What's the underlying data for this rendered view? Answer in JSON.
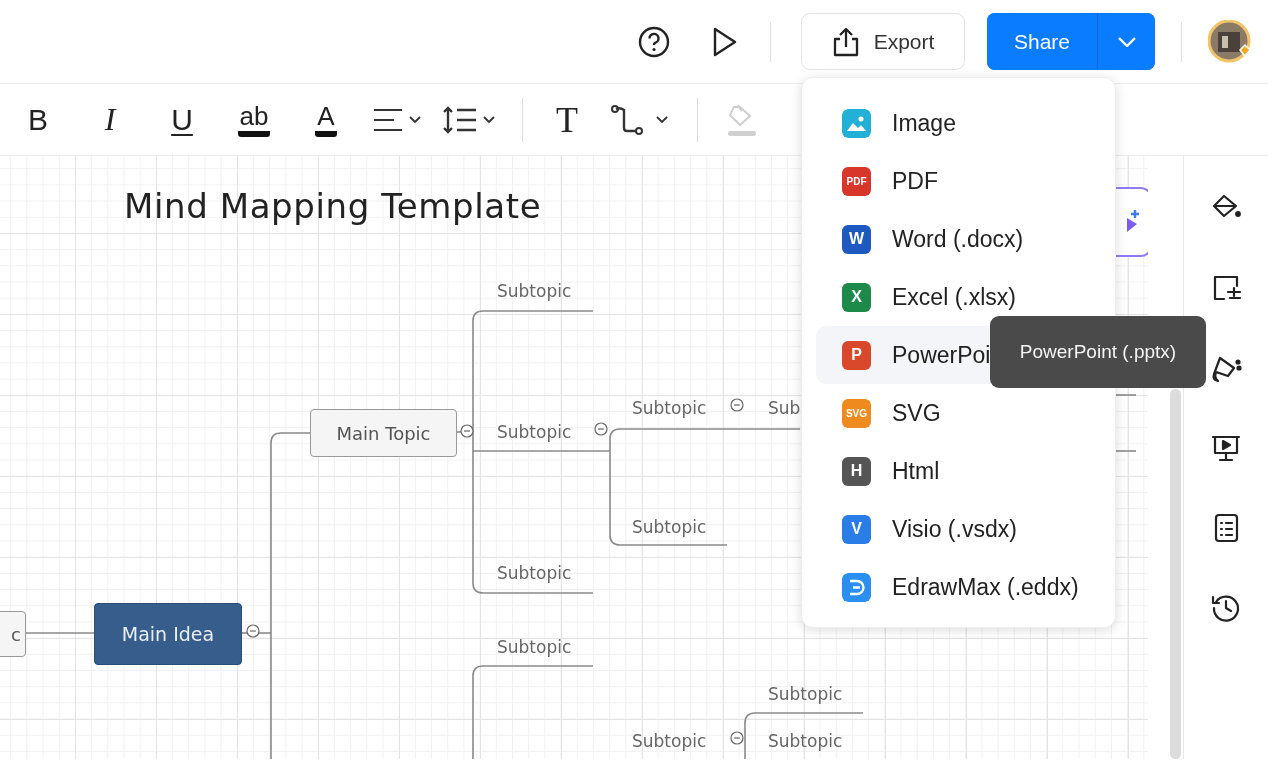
{
  "topbar": {
    "export_button": {
      "label": "Export"
    },
    "share_button": {
      "label": "Share"
    }
  },
  "toolbar_groups": [
    {
      "items": [
        {
          "kind": "bold",
          "glyph": "B"
        },
        {
          "kind": "italic",
          "glyph": "I"
        },
        {
          "kind": "underline",
          "glyph": "U"
        },
        {
          "kind": "highlight",
          "glyph": "ab"
        },
        {
          "kind": "font-color",
          "glyph": "A"
        },
        {
          "kind": "align"
        },
        {
          "kind": "spacing"
        }
      ]
    },
    {
      "items": [
        {
          "kind": "text",
          "glyph": "T"
        },
        {
          "kind": "connector"
        }
      ]
    },
    {
      "items": [
        {
          "kind": "fill",
          "disabled": true
        }
      ]
    }
  ],
  "canvas": {
    "title": "Mind Mapping Template",
    "nodes": [
      {
        "kind": "partial-box",
        "label": "c"
      },
      {
        "kind": "root",
        "label": "Main Idea",
        "expanded": true
      },
      {
        "kind": "topic",
        "label": "Main Topic",
        "expanded": true
      },
      {
        "kind": "subtopic",
        "label": "Subtopic"
      },
      {
        "kind": "subtopic",
        "label": "Subtopic",
        "expanded": true
      },
      {
        "kind": "subtopic",
        "label": "Subtopic",
        "expanded": true
      },
      {
        "kind": "subtopic",
        "label": "Sub"
      },
      {
        "kind": "subtopic",
        "label": "Subtopic"
      },
      {
        "kind": "subtopic",
        "label": "Subtopic"
      },
      {
        "kind": "subtopic",
        "label": "Subtopic"
      },
      {
        "kind": "subtopic",
        "label": "Subtopic"
      },
      {
        "kind": "subtopic",
        "label": "Subtopic",
        "expanded": true
      },
      {
        "kind": "subtopic",
        "label": "Subtopic"
      }
    ]
  },
  "export_menu": {
    "items": [
      {
        "label": "Image",
        "kind": "image",
        "color": "#23b0d6",
        "hovered": false
      },
      {
        "label": "PDF",
        "kind": "badge",
        "badge": "PDF",
        "color": "#d8362b",
        "hovered": false
      },
      {
        "label": "Word (.docx)",
        "kind": "badge",
        "badge": "W",
        "color": "#1d59c0",
        "hovered": false
      },
      {
        "label": "Excel (.xlsx)",
        "kind": "badge",
        "badge": "X",
        "color": "#1e8a4a",
        "hovered": false
      },
      {
        "label": "PowerPoi",
        "kind": "badge",
        "badge": "P",
        "color": "#d9482a",
        "hovered": true
      },
      {
        "label": "SVG",
        "kind": "badge",
        "badge": "SVG",
        "color": "#ee8a1e",
        "hovered": false
      },
      {
        "label": "Html",
        "kind": "badge",
        "badge": "H",
        "color": "#555555",
        "hovered": false
      },
      {
        "label": "Visio (.vsdx)",
        "kind": "badge",
        "badge": "V",
        "color": "#2a7ce6",
        "hovered": false
      },
      {
        "label": "EdrawMax (.eddx)",
        "kind": "edraw",
        "color": "#2b8ff2",
        "hovered": false
      }
    ]
  },
  "tooltip": {
    "text": "PowerPoint (.pptx)"
  }
}
